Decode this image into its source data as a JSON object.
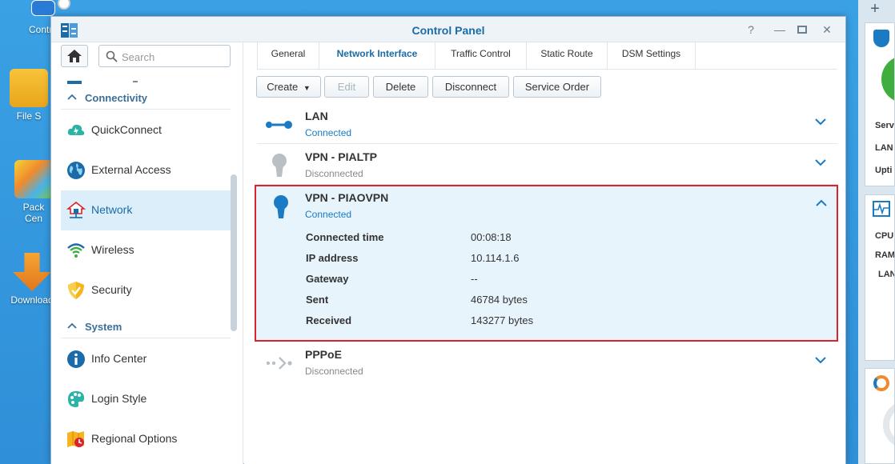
{
  "desktop": {
    "icons": [
      {
        "label": "Contro"
      },
      {
        "label": "File S"
      },
      {
        "label": "Pack\nCen"
      },
      {
        "label": "Download"
      }
    ]
  },
  "window": {
    "title": "Control Panel"
  },
  "sidebar": {
    "search_placeholder": "Search",
    "sections": {
      "connectivity": "Connectivity",
      "system": "System"
    },
    "items": [
      {
        "label": "QuickConnect"
      },
      {
        "label": "External Access"
      },
      {
        "label": "Network"
      },
      {
        "label": "Wireless"
      },
      {
        "label": "Security"
      },
      {
        "label": "Info Center"
      },
      {
        "label": "Login Style"
      },
      {
        "label": "Regional Options"
      }
    ]
  },
  "tabs": [
    {
      "label": "General"
    },
    {
      "label": "Network Interface"
    },
    {
      "label": "Traffic Control"
    },
    {
      "label": "Static Route"
    },
    {
      "label": "DSM Settings"
    }
  ],
  "toolbar": {
    "create": "Create",
    "edit": "Edit",
    "delete": "Delete",
    "disconnect": "Disconnect",
    "service_order": "Service Order"
  },
  "interfaces": [
    {
      "name": "LAN",
      "status": "Connected",
      "status_color": "#1a7ac4"
    },
    {
      "name": "VPN - PIALTP",
      "status": "Disconnected",
      "status_color": "#888888"
    },
    {
      "name": "VPN - PIAOVPN",
      "status": "Connected",
      "status_color": "#1a7ac4",
      "details": [
        {
          "label": "Connected time",
          "value": "00:08:18"
        },
        {
          "label": "IP address",
          "value": "10.114.1.6"
        },
        {
          "label": "Gateway",
          "value": "--"
        },
        {
          "label": "Sent",
          "value": "46784 bytes"
        },
        {
          "label": "Received",
          "value": "143277 bytes"
        }
      ]
    },
    {
      "name": "PPPoE",
      "status": "Disconnected",
      "status_color": "#888888"
    }
  ],
  "widgets": {
    "labels": [
      "Serv",
      "LAN",
      "Upti",
      "CPU",
      "RAM",
      "LAN"
    ]
  },
  "colors": {
    "accent": "#1a6ba8",
    "highlight_border": "#d9232e",
    "selected_bg": "#dceefa"
  }
}
